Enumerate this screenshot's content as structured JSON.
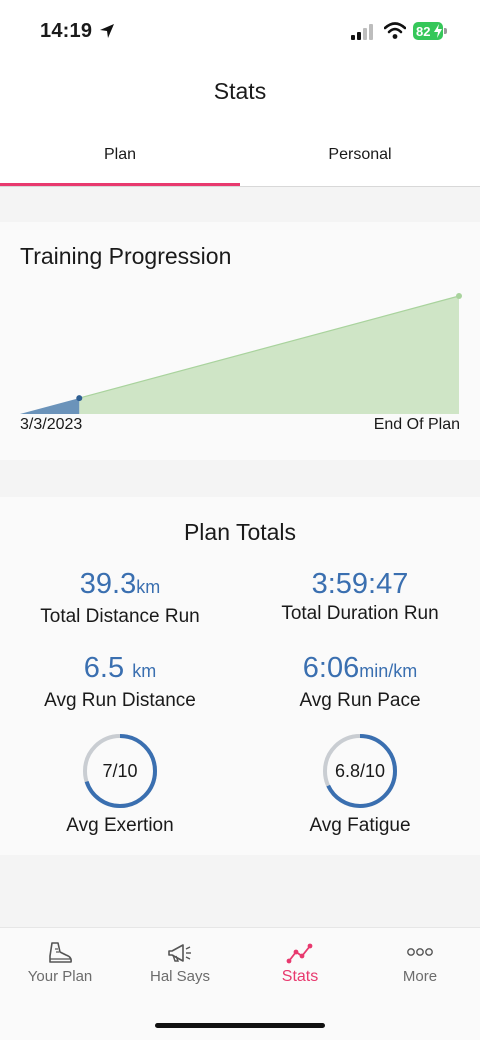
{
  "status_bar": {
    "time": "14:19",
    "battery": "82",
    "location_icon": "location-arrow-icon",
    "signal_icon": "cellular-signal-icon",
    "wifi_icon": "wifi-icon",
    "battery_color": "#35c759"
  },
  "header": {
    "title": "Stats"
  },
  "tabs": [
    {
      "label": "Plan",
      "active": true
    },
    {
      "label": "Personal",
      "active": false
    }
  ],
  "training_progression": {
    "title": "Training Progression",
    "start_label": "3/3/2023",
    "end_label": "End Of Plan",
    "completed_fraction": 0.135,
    "completed_color": "#5b87b3",
    "remaining_color": "#cfe5c6"
  },
  "plan_totals": {
    "title": "Plan Totals",
    "total_distance": {
      "value": "39.3",
      "unit": "km",
      "label": "Total Distance Run"
    },
    "total_duration": {
      "value": "3:59:47",
      "label": "Total Duration Run"
    },
    "avg_distance": {
      "value": "6.5",
      "unit": "km",
      "label": "Avg Run Distance"
    },
    "avg_pace": {
      "value": "6:06",
      "unit": "min/km",
      "label": "Avg Run Pace"
    },
    "avg_exertion": {
      "display": "7/10",
      "fraction": 0.7,
      "label": "Avg Exertion"
    },
    "avg_fatigue": {
      "display": "6.8/10",
      "fraction": 0.68,
      "label": "Avg Fatigue"
    },
    "accent_color": "#3a6fb0"
  },
  "tabbar": {
    "items": [
      {
        "label": "Your Plan",
        "icon": "running-shoe-icon",
        "active": false
      },
      {
        "label": "Hal Says",
        "icon": "megaphone-icon",
        "active": false
      },
      {
        "label": "Stats",
        "icon": "stats-line-icon",
        "active": true
      },
      {
        "label": "More",
        "icon": "more-dots-icon",
        "active": false
      }
    ],
    "active_color": "#e8396e"
  }
}
